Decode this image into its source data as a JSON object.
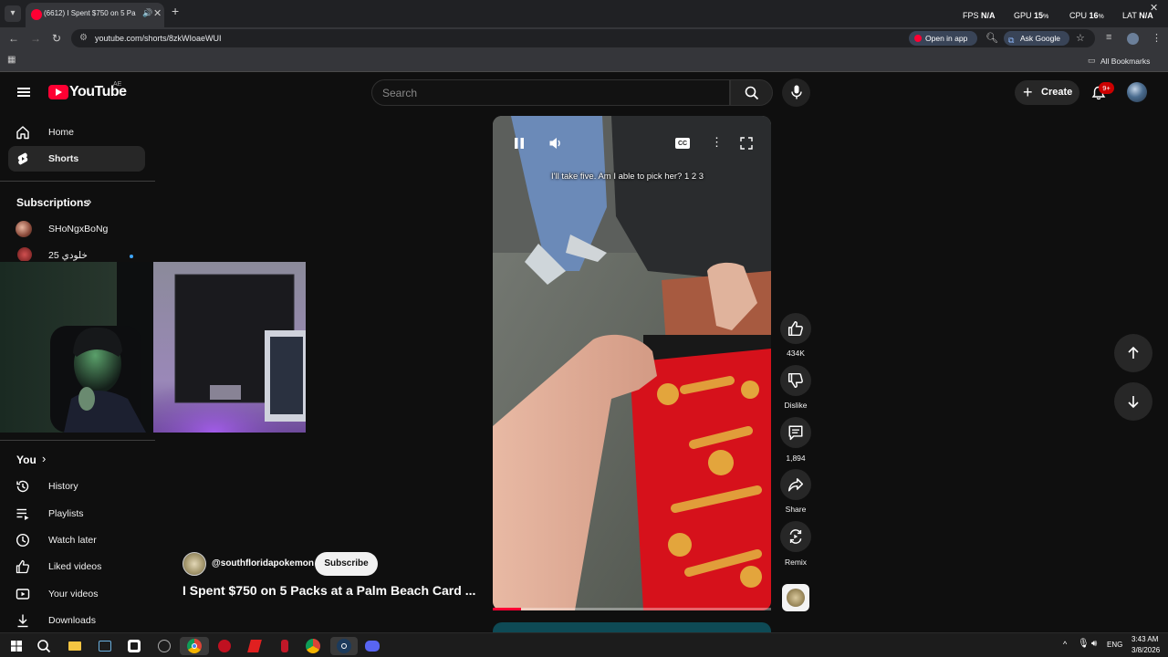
{
  "browser": {
    "tab_title": "(6612) I Spent $750 on 5 Pa",
    "url": "youtube.com/shorts/8zkWIoaeWUI",
    "open_in_app": "Open in app",
    "ask_google": "Ask Google",
    "all_bookmarks": "All Bookmarks"
  },
  "overlay_stats": {
    "fps_label": "FPS",
    "fps_value": "N/A",
    "gpu_label": "GPU",
    "gpu_value": "15",
    "cpu_label": "CPU",
    "cpu_value": "16",
    "lat_label": "LAT",
    "lat_value": "N/A",
    "percent": "%"
  },
  "youtube": {
    "logo_text": "YouTube",
    "country_code": "AE",
    "search_placeholder": "Search",
    "create_label": "Create",
    "notifications_badge": "9+"
  },
  "sidebar": {
    "home": "Home",
    "shorts": "Shorts",
    "subscriptions_heading": "Subscriptions",
    "subscriptions": [
      "SHoNgxBoNg",
      "خلودي 25"
    ],
    "you_heading": "You",
    "you_items": [
      "History",
      "Playlists",
      "Watch later",
      "Liked videos",
      "Your videos",
      "Downloads"
    ]
  },
  "player": {
    "caption": "I'll take five. Am I able to pick her? 1 2 3",
    "cc_label": "CC",
    "progress_fraction": 0.1
  },
  "actions": {
    "likes": "434K",
    "dislike": "Dislike",
    "comments": "1,894",
    "share": "Share",
    "remix": "Remix"
  },
  "short": {
    "channel": "@southfloridapokemon",
    "subscribe": "Subscribe",
    "title": "I Spent $750 on 5 Packs at a Palm Beach Card ..."
  },
  "taskbar": {
    "lang": "ENG",
    "time": "3:43 AM",
    "date": "3/8/2026"
  }
}
